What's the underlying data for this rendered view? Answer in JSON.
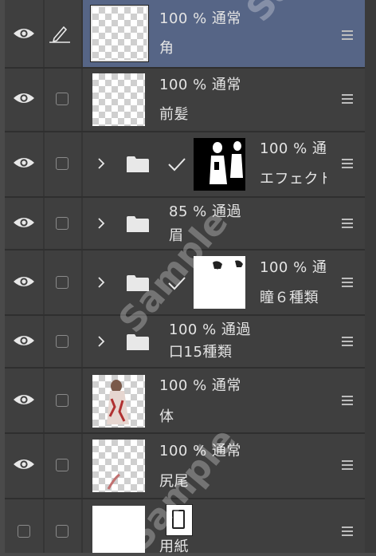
{
  "layers": [
    {
      "id": "tsuno",
      "opacity": "100 %",
      "blend": "通常",
      "name": "角",
      "selected": true,
      "visible": true,
      "kind": "raster"
    },
    {
      "id": "maegami",
      "opacity": "100 %",
      "blend": "通常",
      "name": "前髪",
      "selected": false,
      "visible": true,
      "kind": "raster"
    },
    {
      "id": "effect",
      "opacity": "100 %",
      "blend": "通",
      "name": "エフェクト",
      "selected": false,
      "visible": true,
      "kind": "folder-mask"
    },
    {
      "id": "mayu",
      "opacity": "85 %",
      "blend": "通過",
      "name": "眉",
      "selected": false,
      "visible": true,
      "kind": "folder"
    },
    {
      "id": "hitomi",
      "opacity": "100 %",
      "blend": "通",
      "name": "瞳６種類",
      "selected": false,
      "visible": true,
      "kind": "folder-mask"
    },
    {
      "id": "kuchi",
      "opacity": "100 %",
      "blend": "通過",
      "name": "口15種類",
      "selected": false,
      "visible": true,
      "kind": "folder"
    },
    {
      "id": "karada",
      "opacity": "100 %",
      "blend": "通常",
      "name": "体",
      "selected": false,
      "visible": true,
      "kind": "raster"
    },
    {
      "id": "shippo",
      "opacity": "100 %",
      "blend": "通常",
      "name": "尻尾",
      "selected": false,
      "visible": true,
      "kind": "raster"
    },
    {
      "id": "yoshi",
      "opacity": "",
      "blend": "",
      "name": "用紙",
      "selected": false,
      "visible": false,
      "kind": "paper"
    }
  ],
  "icons": {
    "visibility": "eye-icon",
    "edit": "pencil-icon",
    "expand": "chevron-right-icon",
    "folder": "folder-icon",
    "mask_enabled": "checkmark-icon",
    "menu": "hamburger-menu-icon",
    "paper": "paper-icon"
  },
  "colors": {
    "panel_bg": "#3f3f3f",
    "selected_bg": "#566586",
    "divider": "#2f2f2f",
    "text": "#e4e4e4"
  },
  "watermark": "Sample"
}
